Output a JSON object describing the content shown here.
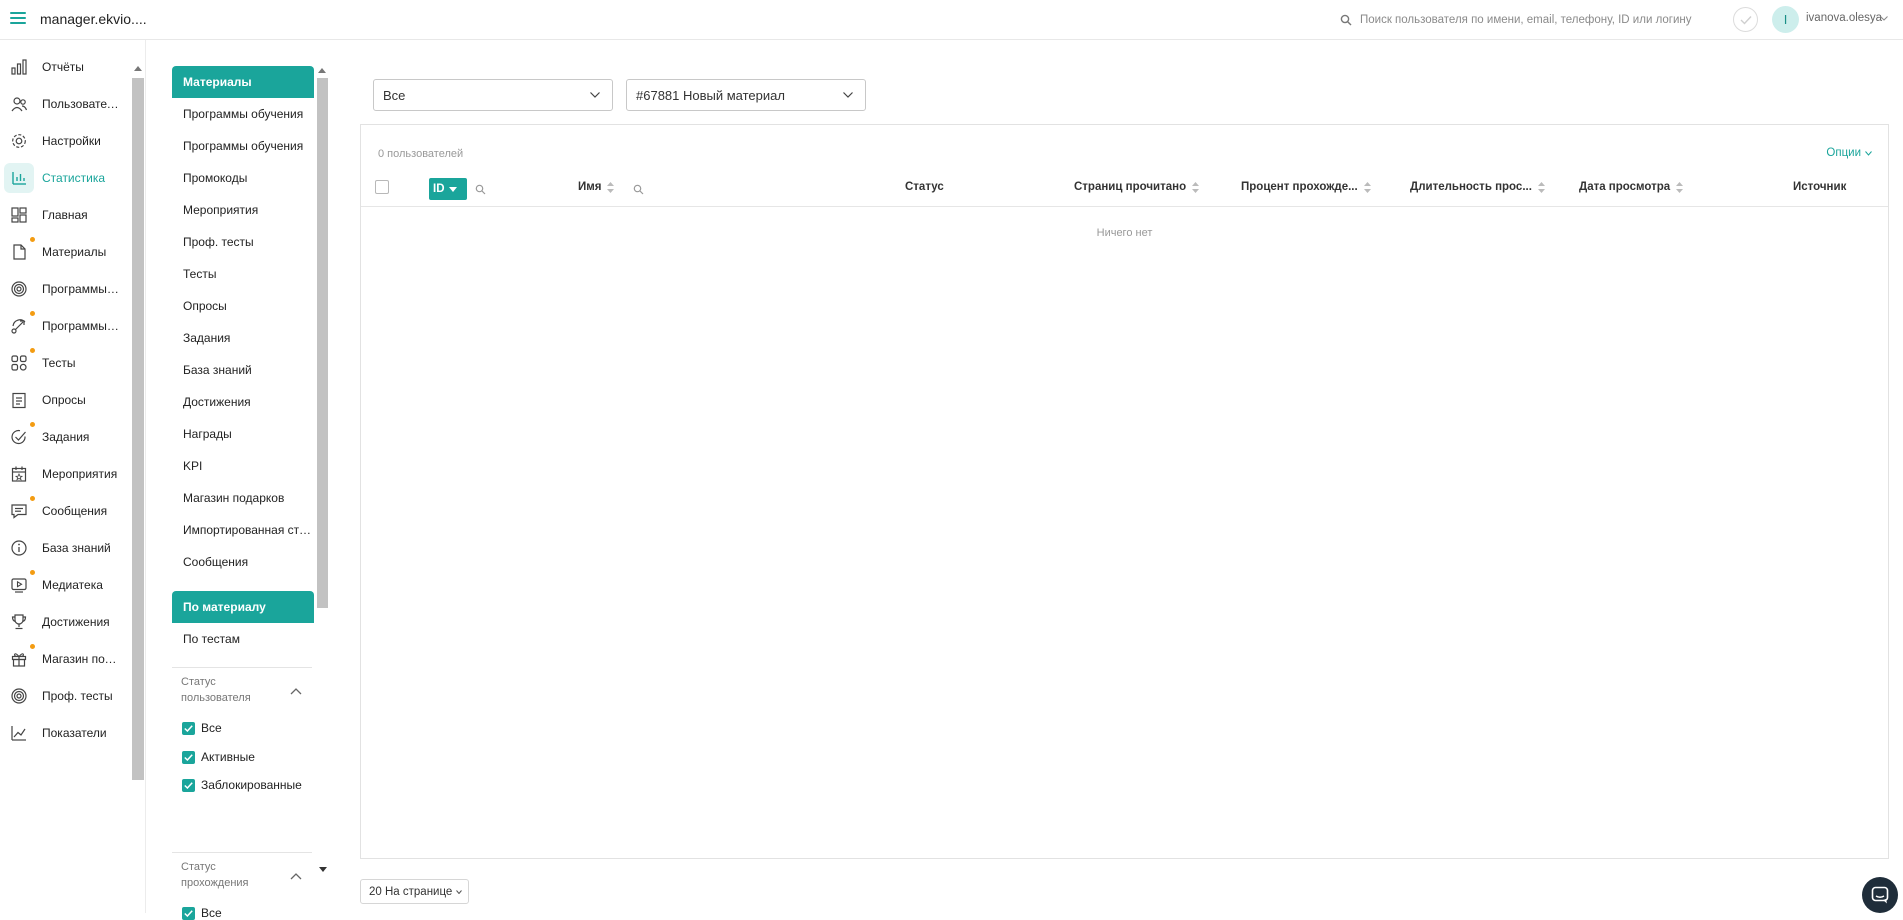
{
  "header": {
    "title": "manager.ekvio....",
    "search_placeholder": "Поиск пользователя по имени, email, телефону, ID или логину",
    "avatar_letter": "I",
    "username": "ivanova.olesya"
  },
  "sidebar": {
    "items": [
      {
        "label": "Отчёты",
        "icon": "reports-icon",
        "dot": false,
        "active": false
      },
      {
        "label": "Пользователи",
        "icon": "users-icon",
        "dot": false,
        "active": false
      },
      {
        "label": "Настройки",
        "icon": "gear-icon",
        "dot": false,
        "active": false
      },
      {
        "label": "Статистика",
        "icon": "statistics-icon",
        "dot": false,
        "active": true
      },
      {
        "label": "Главная",
        "icon": "dashboard-icon",
        "dot": false,
        "active": false
      },
      {
        "label": "Материалы",
        "icon": "document-icon",
        "dot": true,
        "active": false
      },
      {
        "label": "Программы обучения",
        "icon": "target-icon",
        "dot": false,
        "active": false
      },
      {
        "label": "Программы обучения",
        "icon": "route-icon",
        "dot": true,
        "active": false
      },
      {
        "label": "Тесты",
        "icon": "tests-icon",
        "dot": true,
        "active": false
      },
      {
        "label": "Опросы",
        "icon": "survey-icon",
        "dot": false,
        "active": false
      },
      {
        "label": "Задания",
        "icon": "task-check-icon",
        "dot": true,
        "active": false
      },
      {
        "label": "Мероприятия",
        "icon": "calendar-icon",
        "dot": false,
        "active": false
      },
      {
        "label": "Сообщения",
        "icon": "message-icon",
        "dot": true,
        "active": false
      },
      {
        "label": "База знаний",
        "icon": "info-icon",
        "dot": false,
        "active": false
      },
      {
        "label": "Медиатека",
        "icon": "media-icon",
        "dot": true,
        "active": false
      },
      {
        "label": "Достижения",
        "icon": "trophy-icon",
        "dot": false,
        "active": false
      },
      {
        "label": "Магазин подарков",
        "icon": "gift-icon",
        "dot": true,
        "active": false
      },
      {
        "label": "Проф. тесты",
        "icon": "target-icon",
        "dot": false,
        "active": false
      },
      {
        "label": "Показатели",
        "icon": "chart-line-icon",
        "dot": false,
        "active": false
      }
    ]
  },
  "sections": {
    "items": [
      {
        "label": "Материалы",
        "active": true
      },
      {
        "label": "Программы обучения",
        "active": false
      },
      {
        "label": "Программы обучения",
        "active": false
      },
      {
        "label": "Промокоды",
        "active": false
      },
      {
        "label": "Мероприятия",
        "active": false
      },
      {
        "label": "Проф. тесты",
        "active": false
      },
      {
        "label": "Тесты",
        "active": false
      },
      {
        "label": "Опросы",
        "active": false
      },
      {
        "label": "Задания",
        "active": false
      },
      {
        "label": "База знаний",
        "active": false
      },
      {
        "label": "Достижения",
        "active": false
      },
      {
        "label": "Награды",
        "active": false
      },
      {
        "label": "KPI",
        "active": false
      },
      {
        "label": "Магазин подарков",
        "active": false
      },
      {
        "label": "Импортированная статистика",
        "active": false
      },
      {
        "label": "Сообщения",
        "active": false
      }
    ],
    "modes": [
      {
        "label": "По материалу",
        "active": true
      },
      {
        "label": "По тестам",
        "active": false
      }
    ]
  },
  "filters": {
    "user_status": {
      "title": "Статус пользователя",
      "options": [
        {
          "label": "Все",
          "checked": true
        },
        {
          "label": "Активные",
          "checked": true
        },
        {
          "label": "Заблокированные",
          "checked": true
        }
      ]
    },
    "pass_status": {
      "title": "Статус прохождения",
      "options": [
        {
          "label": "Все",
          "checked": true
        }
      ]
    }
  },
  "main": {
    "category_select": "Все",
    "material_select": "#67881 Новый материал",
    "count_label": "0 пользователей",
    "options_label": "Опции",
    "columns": {
      "id": "ID",
      "name": "Имя",
      "status": "Статус",
      "pages_read": "Страниц прочитано",
      "percent": "Процент прохожде...",
      "duration": "Длительность прос...",
      "view_date": "Дата просмотра",
      "source": "Источник"
    },
    "empty_text": "Ничего нет",
    "per_page": "20 На странице"
  },
  "colors": {
    "accent": "#1aa59b",
    "dot": "#f39c12",
    "chat": "#1f2d3a"
  }
}
